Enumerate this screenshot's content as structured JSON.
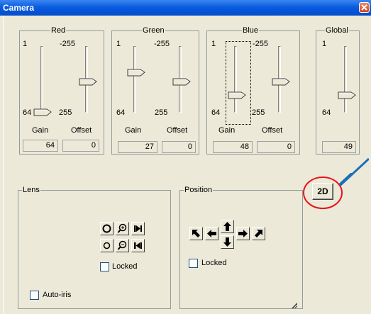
{
  "window": {
    "title": "Camera"
  },
  "red": {
    "title": "Red",
    "gain_top": "1",
    "offset_top": "-255",
    "gain_bottom": "64",
    "offset_bottom": "255",
    "gain_label": "Gain",
    "offset_label": "Offset",
    "gain_value": "64",
    "offset_value": "0"
  },
  "green": {
    "title": "Green",
    "gain_top": "1",
    "offset_top": "-255",
    "gain_bottom": "64",
    "offset_bottom": "255",
    "gain_label": "Gain",
    "offset_label": "Offset",
    "gain_value": "27",
    "offset_value": "0"
  },
  "blue": {
    "title": "Blue",
    "gain_top": "1",
    "offset_top": "-255",
    "gain_bottom": "64",
    "offset_bottom": "255",
    "gain_label": "Gain",
    "offset_label": "Offset",
    "gain_value": "48",
    "offset_value": "0"
  },
  "global": {
    "title": "Global",
    "gain_top": "1",
    "gain_bottom": "64",
    "gain_value": "49"
  },
  "lens": {
    "title": "Lens",
    "locked_label": "Locked",
    "autoiris_label": "Auto-iris",
    "icons": [
      "iris-open-icon",
      "zoom-in-icon",
      "focus-far-icon",
      "iris-close-icon",
      "zoom-out-icon",
      "focus-near-icon"
    ]
  },
  "position": {
    "title": "Position",
    "locked_label": "Locked",
    "icons": [
      "arrow-up-left-icon",
      "arrow-left-icon",
      "arrow-up-icon",
      "arrow-down-icon",
      "arrow-right-icon",
      "arrow-up-right-icon"
    ]
  },
  "mode_button": {
    "label": "2D"
  },
  "annotation": {
    "circle_color": "#e8141a",
    "pointer_color": "#1a6fb8"
  }
}
